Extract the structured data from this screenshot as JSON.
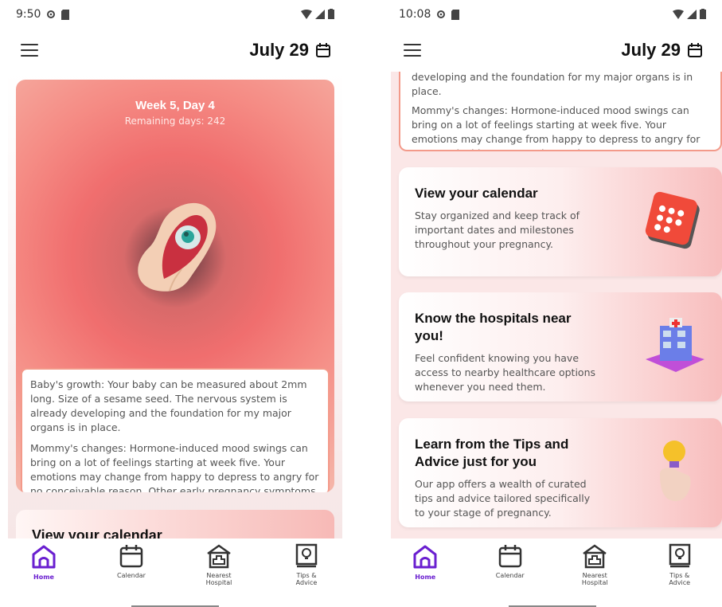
{
  "left": {
    "status": {
      "time": "9:50"
    },
    "appbar": {
      "date": "July 29"
    },
    "week_card": {
      "title": "Week 5, Day 4",
      "remaining": "Remaining days: 242",
      "baby_growth": "Baby's growth: Your baby can be measured about 2mm long. Size of a sesame seed. The nervous system is already developing and the foundation for my major organs is in place.",
      "mommy_changes": "Mommy's changes: Hormone-induced mood swings can bring on a lot of feelings starting at week five. Your emotions may change from happy to depress to angry for no conceivable reason. Other early pregnancy symptoms"
    },
    "peek_card": {
      "title": "View your calendar"
    }
  },
  "right": {
    "status": {
      "time": "10:08"
    },
    "appbar": {
      "date": "July 29"
    },
    "info_top": {
      "line1": "developing and the foundation for my major organs is in place.",
      "mommy_changes": "Mommy's changes: Hormone-induced mood swings can bring on a lot of feelings starting at week five. Your emotions may change from happy to depress to angry for no conceivable reason. Other early pregnancy symptoms"
    },
    "features": [
      {
        "title": "View your calendar",
        "desc": "Stay organized and keep track of important dates and milestones throughout your pregnancy."
      },
      {
        "title": "Know the hospitals near you!",
        "desc": "Feel confident knowing you have access to nearby healthcare options whenever you need them."
      },
      {
        "title": "Learn from the Tips and Advice just for you",
        "desc": "Our app offers a wealth of curated tips and advice tailored specifically to your stage of pregnancy."
      }
    ]
  },
  "nav": {
    "home": "Home",
    "calendar": "Calendar",
    "hospital_line1": "Nearest",
    "hospital_line2": "Hospital",
    "tips_line1": "Tips &",
    "tips_line2": "Advice"
  },
  "colors": {
    "accent": "#6a1fd0",
    "card_coral": "#f06e6e",
    "card_border": "#f39a8a"
  },
  "icons": [
    "menu-icon",
    "calendar-icon",
    "settings-icon",
    "sd-card-icon",
    "wifi-icon",
    "signal-icon",
    "battery-icon",
    "home-icon",
    "hospital-icon",
    "tips-book-icon"
  ]
}
